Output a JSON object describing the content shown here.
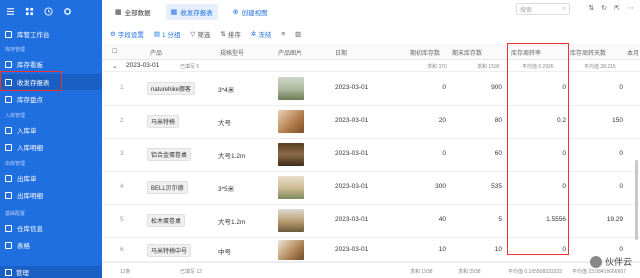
{
  "sidebar": {
    "top_icons": [
      "menu-icon",
      "grid-icon",
      "clock-icon",
      "settings-icon"
    ],
    "items": [
      {
        "label": "库管工作台",
        "section": null
      },
      {
        "label": "库存看板",
        "section": "库存管理"
      },
      {
        "label": "收发存报表",
        "section": null
      },
      {
        "label": "库存盘点",
        "section": null
      },
      {
        "label": "入库单",
        "section": "入库管理"
      },
      {
        "label": "入库明细",
        "section": null
      },
      {
        "label": "出库单",
        "section": "出库管理"
      },
      {
        "label": "出库明细",
        "section": null
      },
      {
        "label": "仓库信息",
        "section": "基础配置"
      },
      {
        "label": "表格",
        "section": null
      }
    ],
    "bottom": "管理"
  },
  "tabs": [
    {
      "label": "全部数据",
      "active": false
    },
    {
      "label": "收发存报表",
      "active": true
    },
    {
      "label": "创建视图",
      "active": false
    }
  ],
  "toolbar": {
    "fields": "字段设置",
    "group": "1 分组",
    "filter": "筛选",
    "sort": "排序",
    "freeze": "冻结"
  },
  "search": {
    "placeholder": "搜索"
  },
  "columns": [
    "产品",
    "规格型号",
    "产品图片",
    "日期",
    "期初库存数",
    "期末库存数",
    "库存周转率",
    "库存周转天数",
    "本月"
  ],
  "group": {
    "date": "2023-03-01",
    "count_label": "已填写 6",
    "sum_open": "求和 370",
    "sum_close": "求和 1590",
    "avg_turnover": "平均值 0.2926",
    "avg_days": "平均值 28.215"
  },
  "rows": [
    {
      "index": "1",
      "product": "naturehike挪客",
      "spec": "3*4米",
      "date": "2023-03-01",
      "open": "0",
      "close": "900",
      "turnover": "0",
      "days": "0"
    },
    {
      "index": "2",
      "product": "马米特椅",
      "spec": "大号",
      "date": "2023-03-01",
      "open": "20",
      "close": "80",
      "turnover": "0.2",
      "days": "150"
    },
    {
      "index": "3",
      "product": "铝合金蛋卷桌",
      "spec": "大号1.2m",
      "date": "2023-03-01",
      "open": "0",
      "close": "60",
      "turnover": "0",
      "days": "0"
    },
    {
      "index": "4",
      "product": "BELL贝尔德",
      "spec": "3*5米",
      "date": "2023-03-01",
      "open": "300",
      "close": "535",
      "turnover": "0",
      "days": "0"
    },
    {
      "index": "5",
      "product": "松木蛋卷桌",
      "spec": "大号1.2m",
      "date": "2023-03-01",
      "open": "40",
      "close": "5",
      "turnover": "1.5556",
      "days": "19.29"
    },
    {
      "index": "6",
      "product": "马米特椅中号",
      "spec": "中号",
      "date": "2023-03-01",
      "open": "10",
      "close": "10",
      "turnover": "0",
      "days": "0"
    }
  ],
  "footer": {
    "count": "12条",
    "filled": "已填写 12",
    "sum_open": "求和 1938",
    "sum_close": "求和 2938",
    "avg_turnover": "平均值 0.165508333333",
    "avg_days": "平均值 23.08416666667"
  },
  "watermark": "伙伴云",
  "colors": {
    "sidebar": "#1f6fe0",
    "accent": "#1f6fe0",
    "highlight": "#e33333"
  }
}
